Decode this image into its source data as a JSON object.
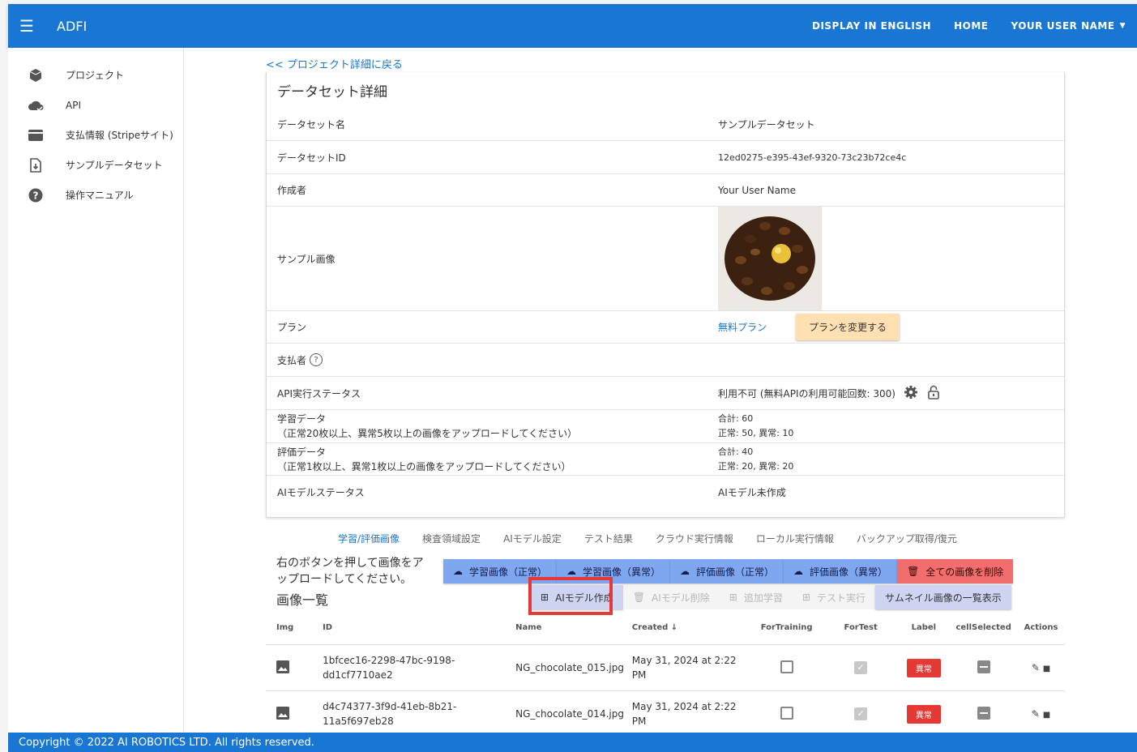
{
  "header": {
    "brand": "ADFI",
    "nav_english": "DISPLAY IN ENGLISH",
    "nav_home": "HOME",
    "nav_user": "YOUR USER NAME"
  },
  "sidebar": {
    "items": [
      {
        "label": "プロジェクト",
        "icon": "cube-icon"
      },
      {
        "label": "API",
        "icon": "cloud-icon"
      },
      {
        "label": "支払情報 (Stripeサイト)",
        "icon": "credit-card-icon"
      },
      {
        "label": "サンプルデータセット",
        "icon": "file-download-icon"
      },
      {
        "label": "操作マニュアル",
        "icon": "help-icon"
      }
    ]
  },
  "main": {
    "back_link": "<< プロジェクト詳細に戻る",
    "card_title": "データセット詳細",
    "rows": {
      "name_label": "データセット名",
      "name_value": "サンプルデータセット",
      "id_label": "データセットID",
      "id_value": "12ed0275-e395-43ef-9320-73c23b72ce4c",
      "creator_label": "作成者",
      "creator_value": "Your User Name",
      "sample_label": "サンプル画像",
      "plan_label": "プラン",
      "plan_value": "無料プラン",
      "plan_button": "プランを変更する",
      "payer_label": "支払者",
      "api_label": "API実行ステータス",
      "api_value": "利用不可 (無料APIの利用可能回数: 300)",
      "train_label": "学習データ",
      "train_note": "（正常20枚以上、異常5枚以上の画像をアップロードしてください）",
      "train_total": "合計: 60",
      "train_detail": "正常: 50, 異常: 10",
      "eval_label": "評価データ",
      "eval_note": "（正常1枚以上、異常1枚以上の画像をアップロードしてください）",
      "eval_total": "合計: 40",
      "eval_detail": "正常: 20, 異常: 20",
      "model_label": "AIモデルステータス",
      "model_value": "AIモデル未作成"
    },
    "tabs": [
      "学習/評価画像",
      "検査領域設定",
      "AIモデル設定",
      "テスト結果",
      "クラウド実行情報",
      "ローカル実行情報",
      "バックアップ取得/復元"
    ],
    "hint": "右のボタンを押して画像をアップロードしてください。",
    "image_list_title": "画像一覧",
    "buttons_row1": [
      "学習画像（正常）",
      "学習画像（異常）",
      "評価画像（正常）",
      "評価画像（異常）",
      "全ての画像を削除"
    ],
    "buttons_row2": [
      "AIモデル作成",
      "AIモデル削除",
      "追加学習",
      "テスト実行",
      "サムネイル画像の一覧表示"
    ]
  },
  "table": {
    "headers": {
      "img": "Img",
      "id": "ID",
      "name": "Name",
      "created": "Created",
      "fortraining": "ForTraining",
      "fortest": "ForTest",
      "label": "Label",
      "cellselected": "cellSelected",
      "actions": "Actions"
    },
    "rows": [
      {
        "id": "1bfcec16-2298-47bc-9198-dd1cf7710ae2",
        "name": "NG_chocolate_015.jpg",
        "created": "May 31, 2024 at 2:22 PM",
        "label": "異常"
      },
      {
        "id": "d4c74377-3f9d-41eb-8b21-11a5f697eb28",
        "name": "NG_chocolate_014.jpg",
        "created": "May 31, 2024 at 2:22 PM",
        "label": "異常"
      }
    ]
  },
  "footer": {
    "text": "Copyright © 2022 AI ROBOTICS LTD. All rights reserved."
  },
  "colors": {
    "primary": "#1976d2",
    "danger": "#e53935",
    "plan_button": "#ffe0b2",
    "upload_button": "#7ea7f0"
  }
}
